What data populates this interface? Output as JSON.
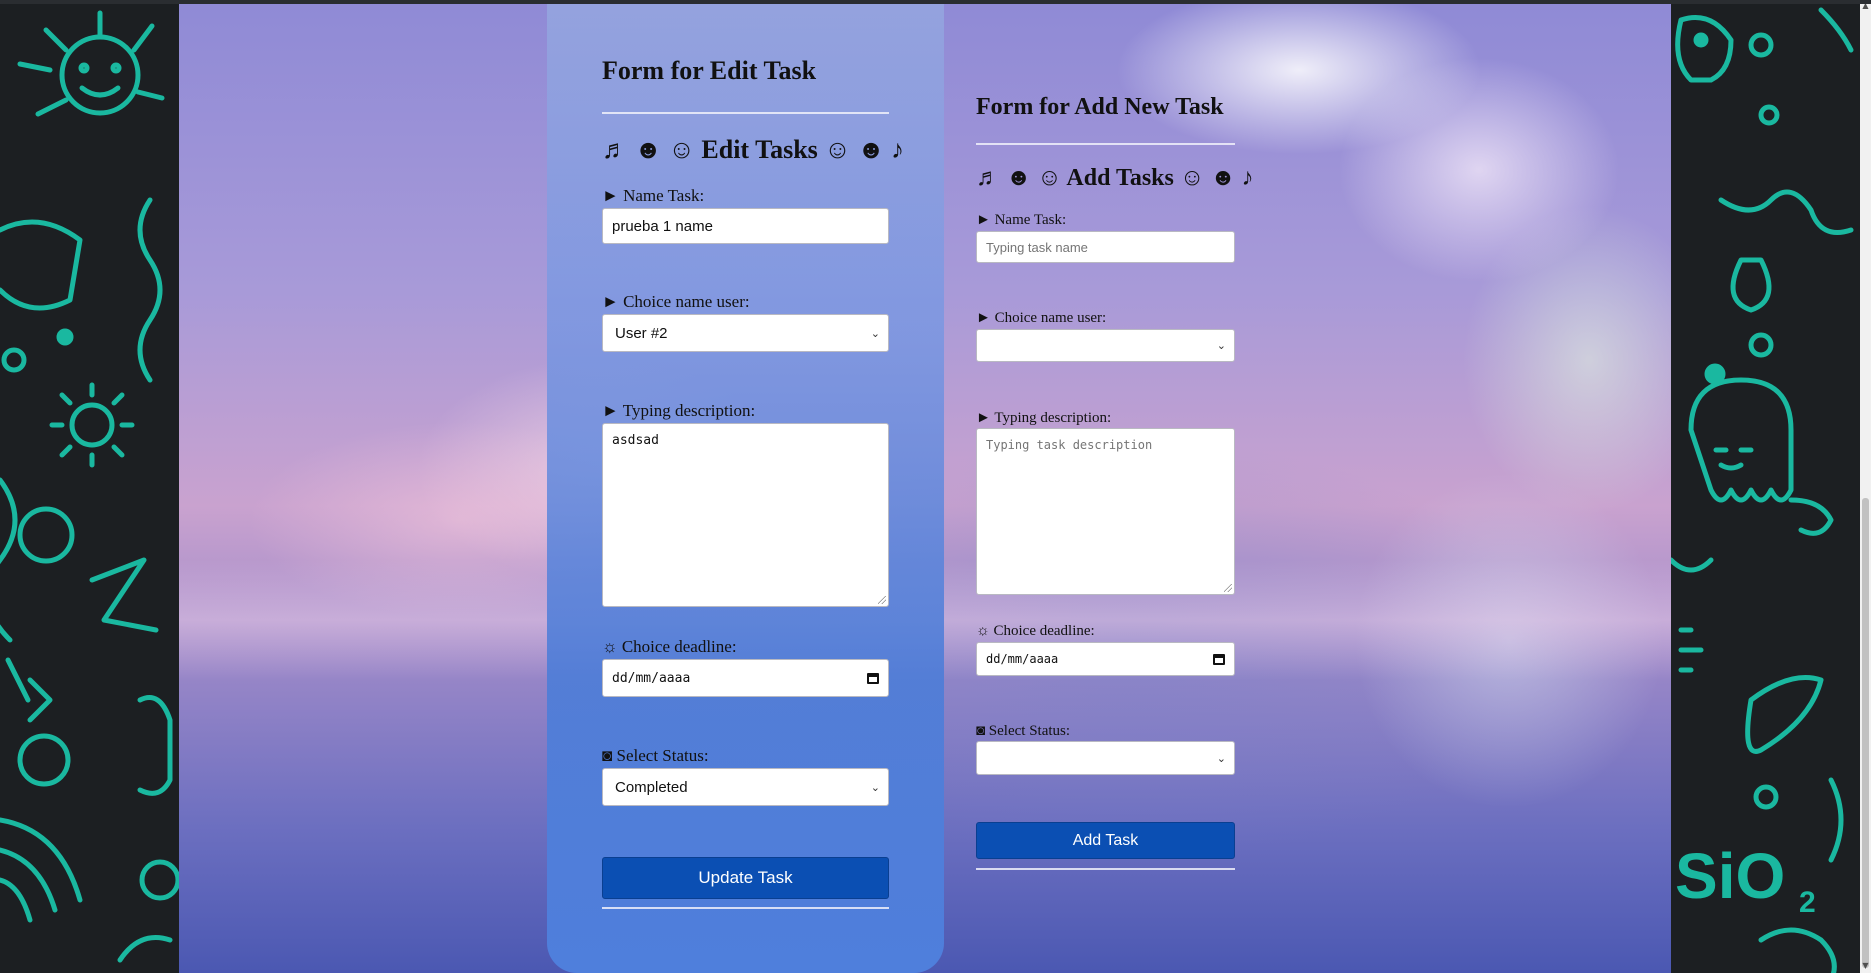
{
  "edit_form": {
    "title": "Form for Edit Task",
    "heading": "♬ ☻ ☺ Edit Tasks ☺ ☻ ♪",
    "name_label": "► Name Task:",
    "name_value": "prueba 1 name",
    "user_label": "► Choice name user:",
    "user_value": "User #2",
    "description_label": "► Typing description:",
    "description_value": "asdsad",
    "deadline_label": "☼ Choice deadline:",
    "deadline_value": "dd/mm/aaaa",
    "status_label": "◙ Select Status:",
    "status_value": "Completed",
    "submit_label": "Update Task"
  },
  "add_form": {
    "title": "Form for Add New Task",
    "heading": "♬ ☻ ☺ Add Tasks ☺ ☻ ♪",
    "name_label": "► Name Task:",
    "name_placeholder": "Typing task name",
    "user_label": "► Choice name user:",
    "user_value": "",
    "description_label": "► Typing description:",
    "description_placeholder": "Typing task description",
    "deadline_label": "☼ Choice deadline:",
    "deadline_value": "dd/mm/aaaa",
    "status_label": "◙ Select Status:",
    "status_value": "",
    "submit_label": "Add Task"
  },
  "icons": {
    "select_chevron": "chevron-down-icon",
    "calendar": "calendar-icon",
    "scroll_up": "scroll-up-arrow-icon",
    "scroll_down": "scroll-down-arrow-icon"
  },
  "colors": {
    "button": "#0b4fb3",
    "card": "#4f7fdc",
    "doodle": "#1ab8a0",
    "side_background": "#1c1f22"
  }
}
